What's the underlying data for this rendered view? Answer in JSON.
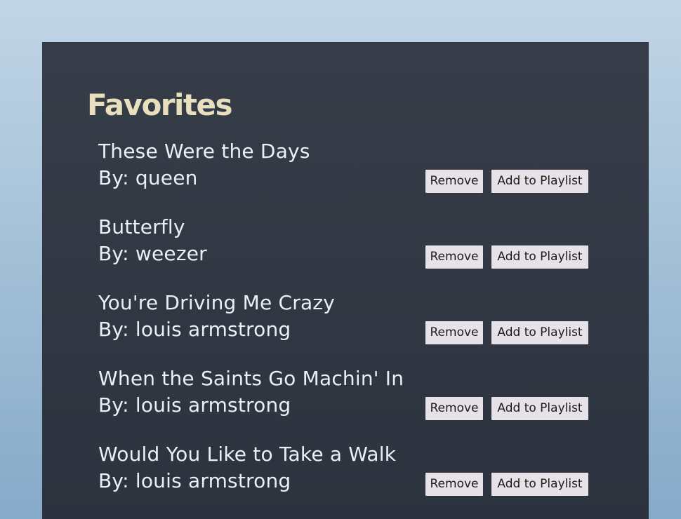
{
  "favorites": {
    "title": "Favorites",
    "remove_label": "Remove",
    "add_label": "Add to Playlist",
    "songs": [
      {
        "title": "These Were the Days",
        "artist": "By: queen"
      },
      {
        "title": "Butterfly",
        "artist": "By: weezer"
      },
      {
        "title": "You're Driving Me Crazy",
        "artist": "By: louis armstrong"
      },
      {
        "title": "When the Saints Go Machin' In",
        "artist": "By: louis armstrong"
      },
      {
        "title": "Would You Like to Take a Walk",
        "artist": "By: louis armstrong"
      }
    ]
  }
}
